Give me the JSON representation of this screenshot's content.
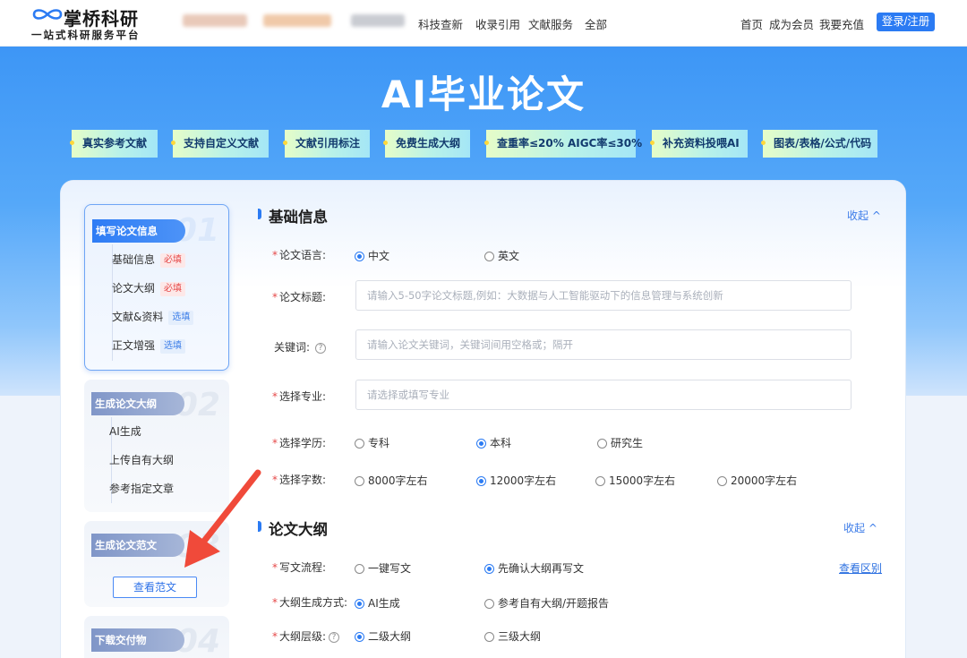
{
  "header": {
    "logo_title": "掌桥科研",
    "logo_subtitle": "一站式科研服务平台",
    "nav": [
      "科技查新",
      "收录引用",
      "文献服务",
      "全部"
    ],
    "right_nav": [
      "首页",
      "成为会员",
      "我要充值"
    ],
    "login": "登录/注册"
  },
  "hero": {
    "title": "AI毕业论文",
    "tags": [
      "真实参考文献",
      "支持自定义文献",
      "文献引用标注",
      "免费生成大纲",
      "查重率≤20%  AIGC率≤30%",
      "补充资料投喂AI",
      "图表/表格/公式/代码"
    ]
  },
  "sidebar": {
    "steps": [
      {
        "num": "01",
        "title": "填写论文信息",
        "items": [
          {
            "label": "基础信息",
            "badge": "必填"
          },
          {
            "label": "论文大纲",
            "badge": "必填"
          },
          {
            "label": "文献&资料",
            "badge": "选填"
          },
          {
            "label": "正文增强",
            "badge": "选填"
          }
        ]
      },
      {
        "num": "02",
        "title": "生成论文大纲",
        "items": [
          {
            "label": "AI生成"
          },
          {
            "label": "上传自有大纲"
          },
          {
            "label": "参考指定文章"
          }
        ]
      },
      {
        "num": "03",
        "title": "生成论文范文",
        "button": "查看范文"
      },
      {
        "num": "04",
        "title": "下载交付物"
      }
    ]
  },
  "basic": {
    "title": "基础信息",
    "collapse": "收起 ^",
    "language": {
      "label": "论文语言:",
      "options": [
        "中文",
        "英文"
      ],
      "selected": "中文"
    },
    "paper_title": {
      "label": "论文标题:",
      "placeholder": "请输入5-50字论文标题,例如：大数据与人工智能驱动下的信息管理与系统创新"
    },
    "keywords": {
      "label": "关键词:",
      "help": "?",
      "placeholder": "请输入论文关键词，关键词间用空格或；隔开"
    },
    "major": {
      "label": "选择专业:",
      "placeholder": "请选择或填写专业"
    },
    "degree": {
      "label": "选择学历:",
      "options": [
        "专科",
        "本科",
        "研究生"
      ],
      "selected": "本科"
    },
    "words": {
      "label": "选择字数:",
      "options": [
        "8000字左右",
        "12000字左右",
        "15000字左右",
        "20000字左右"
      ],
      "selected": "12000字左右"
    }
  },
  "outline": {
    "title": "论文大纲",
    "collapse": "收起 ^",
    "flow": {
      "label": "写文流程:",
      "options": [
        "一键写文",
        "先确认大纲再写文"
      ],
      "selected": "先确认大纲再写文",
      "link": "查看区别"
    },
    "method": {
      "label": "大纲生成方式:",
      "options": [
        "AI生成",
        "参考自有大纲/开题报告"
      ],
      "selected": "AI生成"
    },
    "level": {
      "label": "大纲层级:",
      "help": "?",
      "options": [
        "二级大纲",
        "三级大纲"
      ],
      "selected": "二级大纲"
    }
  },
  "colors": {
    "accent": "#2b7bf3",
    "arrow": "#f04a3a"
  }
}
